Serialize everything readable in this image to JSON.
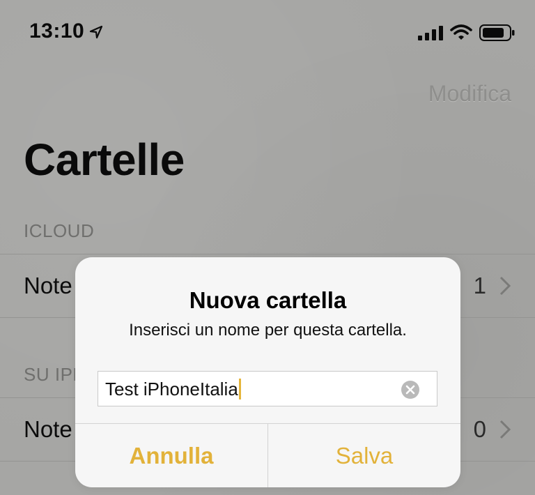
{
  "status_bar": {
    "time": "13:10",
    "icons": [
      "location-arrow-icon",
      "cellular-signal-icon",
      "wifi-icon",
      "battery-icon"
    ]
  },
  "nav": {
    "edit_label": "Modifica"
  },
  "title": "Cartelle",
  "sections": [
    {
      "header": "ICLOUD",
      "rows": [
        {
          "label": "Note",
          "count": "1"
        }
      ]
    },
    {
      "header": "SU IPHONE",
      "rows": [
        {
          "label": "Note",
          "count": "0"
        }
      ]
    }
  ],
  "dialog": {
    "title": "Nuova cartella",
    "message": "Inserisci un nome per questa cartella.",
    "field_value": "Test iPhoneItalia",
    "cancel_label": "Annulla",
    "save_label": "Salva"
  },
  "colors": {
    "accent": "#e2b23a",
    "background": "#a6a6a4",
    "dialog": "#f6f6f6"
  }
}
